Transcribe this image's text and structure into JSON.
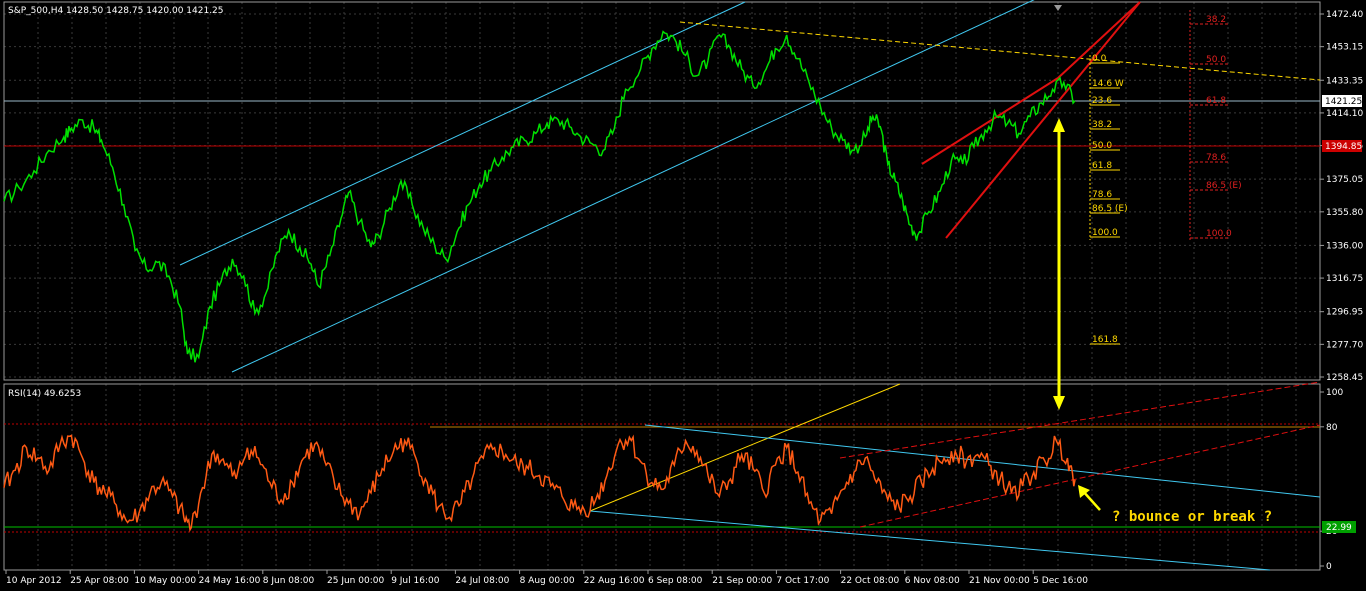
{
  "colors": {
    "background": "#000000",
    "grid": "#3a3a3a",
    "price": "#00e000",
    "rsi": "#ff5a14",
    "channel": "#40c8f0",
    "wedge": "#e01010",
    "fib_yellow": "#ffd800",
    "fib_red": "#e02020",
    "hline_red": "#c00000",
    "hline_green": "#00c000",
    "hline_rsi80": "#c08000",
    "price_tag": "#ffffff",
    "red_tag": "#cc0000",
    "green_tag": "#00a000"
  },
  "header": {
    "main": "S&P_500,H4  1428.50 1428.75 1420.00 1421.25",
    "indicator": "RSI(14) 49.6253"
  },
  "chart_data": [
    {
      "type": "line",
      "name": "S&P_500,H4",
      "x_tick_labels": [
        "10 Apr 2012",
        "25 Apr 08:00",
        "10 May 00:00",
        "24 May 16:00",
        "8 Jun 08:00",
        "25 Jun 00:00",
        "9 Jul 16:00",
        "24 Jul 08:00",
        "8 Aug 00:00",
        "22 Aug 16:00",
        "6 Sep 08:00",
        "21 Sep 00:00",
        "7 Oct 17:00",
        "22 Oct 08:00",
        "6 Nov 08:00",
        "21 Nov 00:00",
        "5 Dec 16:00"
      ],
      "y_tick_labels": [
        "1472.40",
        "1453.15",
        "1433.35",
        "1414.10",
        "1394.85",
        "1375.05",
        "1355.80",
        "1336.00",
        "1316.75",
        "1296.95",
        "1277.70",
        "1258.45"
      ],
      "ylim": [
        1258.45,
        1472.4
      ],
      "current_price": "1421.25",
      "red_level": "1394.85",
      "series_points": [
        [
          0,
          1362
        ],
        [
          4,
          1370
        ],
        [
          8,
          1380
        ],
        [
          12,
          1392
        ],
        [
          16,
          1400
        ],
        [
          18,
          1405
        ],
        [
          21,
          1410
        ],
        [
          24,
          1405
        ],
        [
          26,
          1398
        ],
        [
          29,
          1382
        ],
        [
          32,
          1360
        ],
        [
          35,
          1333
        ],
        [
          38,
          1322
        ],
        [
          41,
          1326
        ],
        [
          44,
          1318
        ],
        [
          47,
          1300
        ],
        [
          49,
          1272
        ],
        [
          52,
          1270
        ],
        [
          55,
          1300
        ],
        [
          58,
          1315
        ],
        [
          61,
          1328
        ],
        [
          64,
          1318
        ],
        [
          67,
          1296
        ],
        [
          70,
          1308
        ],
        [
          73,
          1332
        ],
        [
          76,
          1345
        ],
        [
          79,
          1335
        ],
        [
          82,
          1325
        ],
        [
          84,
          1312
        ],
        [
          87,
          1330
        ],
        [
          90,
          1352
        ],
        [
          92,
          1367
        ],
        [
          95,
          1350
        ],
        [
          98,
          1335
        ],
        [
          100,
          1342
        ],
        [
          103,
          1358
        ],
        [
          106,
          1374
        ],
        [
          109,
          1360
        ],
        [
          112,
          1346
        ],
        [
          115,
          1336
        ],
        [
          118,
          1328
        ],
        [
          121,
          1344
        ],
        [
          124,
          1360
        ],
        [
          127,
          1372
        ],
        [
          130,
          1380
        ],
        [
          133,
          1388
        ],
        [
          136,
          1394
        ],
        [
          139,
          1398
        ],
        [
          142,
          1402
        ],
        [
          145,
          1408
        ],
        [
          148,
          1410
        ],
        [
          151,
          1406
        ],
        [
          154,
          1400
        ],
        [
          157,
          1396
        ],
        [
          160,
          1392
        ],
        [
          163,
          1405
        ],
        [
          166,
          1428
        ],
        [
          170,
          1440
        ],
        [
          173,
          1452
        ],
        [
          176,
          1462
        ],
        [
          179,
          1458
        ],
        [
          182,
          1448
        ],
        [
          185,
          1436
        ],
        [
          188,
          1445
        ],
        [
          191,
          1460
        ],
        [
          194,
          1452
        ],
        [
          197,
          1440
        ],
        [
          200,
          1430
        ],
        [
          203,
          1438
        ],
        [
          206,
          1452
        ],
        [
          209,
          1460
        ],
        [
          212,
          1446
        ],
        [
          215,
          1432
        ],
        [
          218,
          1418
        ],
        [
          221,
          1405
        ],
        [
          224,
          1398
        ],
        [
          227,
          1392
        ],
        [
          230,
          1400
        ],
        [
          232,
          1412
        ],
        [
          234,
          1406
        ],
        [
          236,
          1384
        ],
        [
          238,
          1374
        ],
        [
          240,
          1362
        ],
        [
          242,
          1348
        ],
        [
          244,
          1342
        ],
        [
          247,
          1356
        ],
        [
          250,
          1368
        ],
        [
          253,
          1386
        ],
        [
          256,
          1384
        ],
        [
          259,
          1394
        ],
        [
          262,
          1404
        ],
        [
          265,
          1412
        ],
        [
          268,
          1408
        ],
        [
          271,
          1402
        ],
        [
          274,
          1412
        ],
        [
          277,
          1420
        ],
        [
          280,
          1428
        ],
        [
          283,
          1432
        ],
        [
          286,
          1421.25
        ]
      ]
    },
    {
      "type": "line",
      "name": "RSI(14)",
      "value": "49.6253",
      "y_tick_labels": [
        "100",
        "80",
        "20",
        "0"
      ],
      "ylim": [
        0,
        100
      ],
      "level_label": "22.99",
      "series_points": [
        [
          0,
          45
        ],
        [
          3,
          55
        ],
        [
          6,
          68
        ],
        [
          9,
          62
        ],
        [
          12,
          55
        ],
        [
          15,
          70
        ],
        [
          18,
          75
        ],
        [
          21,
          62
        ],
        [
          24,
          48
        ],
        [
          27,
          42
        ],
        [
          30,
          35
        ],
        [
          33,
          25
        ],
        [
          36,
          30
        ],
        [
          39,
          42
        ],
        [
          42,
          48
        ],
        [
          45,
          40
        ],
        [
          48,
          28
        ],
        [
          50,
          22
        ],
        [
          53,
          45
        ],
        [
          56,
          66
        ],
        [
          59,
          58
        ],
        [
          62,
          50
        ],
        [
          65,
          68
        ],
        [
          68,
          62
        ],
        [
          71,
          48
        ],
        [
          74,
          38
        ],
        [
          77,
          48
        ],
        [
          80,
          62
        ],
        [
          83,
          70
        ],
        [
          86,
          58
        ],
        [
          89,
          44
        ],
        [
          92,
          36
        ],
        [
          95,
          30
        ],
        [
          98,
          42
        ],
        [
          101,
          56
        ],
        [
          104,
          66
        ],
        [
          107,
          72
        ],
        [
          110,
          62
        ],
        [
          113,
          48
        ],
        [
          116,
          34
        ],
        [
          119,
          28
        ],
        [
          122,
          36
        ],
        [
          125,
          50
        ],
        [
          128,
          62
        ],
        [
          131,
          68
        ],
        [
          134,
          64
        ],
        [
          137,
          58
        ],
        [
          140,
          56
        ],
        [
          143,
          52
        ],
        [
          146,
          46
        ],
        [
          149,
          40
        ],
        [
          152,
          34
        ],
        [
          155,
          32
        ],
        [
          158,
          38
        ],
        [
          161,
          52
        ],
        [
          164,
          70
        ],
        [
          167,
          74
        ],
        [
          170,
          60
        ],
        [
          173,
          48
        ],
        [
          176,
          44
        ],
        [
          179,
          58
        ],
        [
          182,
          72
        ],
        [
          185,
          66
        ],
        [
          188,
          52
        ],
        [
          191,
          40
        ],
        [
          194,
          50
        ],
        [
          197,
          64
        ],
        [
          200,
          56
        ],
        [
          203,
          42
        ],
        [
          206,
          58
        ],
        [
          209,
          68
        ],
        [
          212,
          54
        ],
        [
          215,
          36
        ],
        [
          218,
          26
        ],
        [
          221,
          30
        ],
        [
          224,
          44
        ],
        [
          227,
          54
        ],
        [
          230,
          62
        ],
        [
          233,
          48
        ],
        [
          236,
          38
        ],
        [
          239,
          34
        ],
        [
          242,
          40
        ],
        [
          245,
          48
        ],
        [
          248,
          56
        ],
        [
          251,
          62
        ],
        [
          254,
          66
        ],
        [
          257,
          60
        ],
        [
          260,
          64
        ],
        [
          263,
          58
        ],
        [
          266,
          50
        ],
        [
          269,
          42
        ],
        [
          272,
          46
        ],
        [
          275,
          54
        ],
        [
          278,
          60
        ],
        [
          281,
          72
        ],
        [
          284,
          62
        ],
        [
          286,
          49.6
        ]
      ]
    }
  ],
  "fib_yellow": [
    "0.0",
    "14.6 W",
    "23.6",
    "38.2",
    "50.0",
    "61.8",
    "78.6",
    "86.5 (E)",
    "100.0",
    "161.8"
  ],
  "fib_red": [
    "38.2",
    "50.0",
    "61.8",
    "78.6",
    "86.5 (E)",
    "100.0"
  ],
  "annotation": "? bounce or break ?"
}
